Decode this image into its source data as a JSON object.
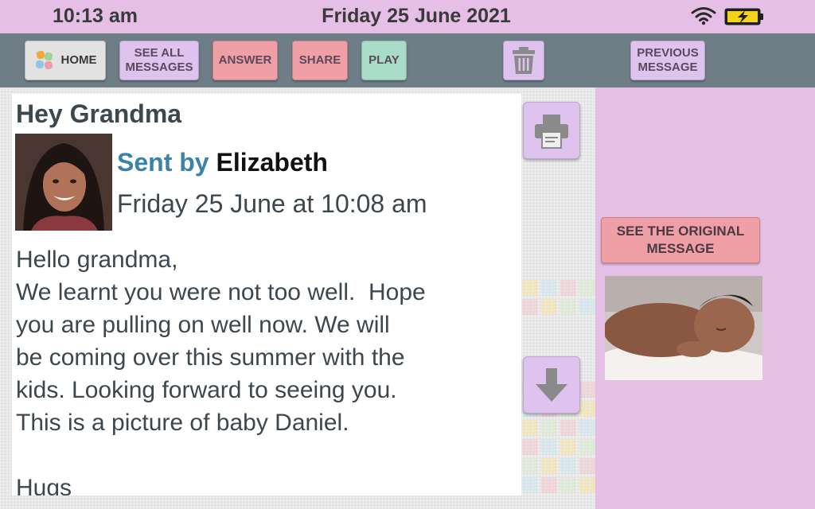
{
  "status_bar": {
    "time": "10:13 am",
    "date": "Friday 25 June 2021",
    "wifi_icon": "wifi-icon",
    "battery_icon": "battery-charging-icon"
  },
  "toolbar": {
    "home_label": "HOME",
    "see_all_label": "SEE ALL\nMESSAGES",
    "answer_label": "ANSWER",
    "share_label": "SHARE",
    "play_label": "PLAY",
    "trash_icon": "trash-icon",
    "previous_label": "PREVIOUS\nMESSAGE"
  },
  "message": {
    "title": "Hey Grandma",
    "sent_by_prefix": "Sent by",
    "sender": "Elizabeth",
    "date": "Friday 25 June at 10:08 am",
    "body": "Hello grandma,\nWe learnt you were not too well.  Hope\nyou are pulling on well now. We will\nbe coming over this summer with the\nkids. Looking forward to seeing you.\nThis is a picture of baby Daniel.\n\nHugs"
  },
  "side_buttons": {
    "print_icon": "printer-icon",
    "down_icon": "arrow-down-icon"
  },
  "right_panel": {
    "original_label": "SEE THE ORIGINAL\nMESSAGE"
  },
  "colors": {
    "status_bar": "#e6bfe6",
    "toolbar": "#6e7d86",
    "lilac_button": "#dfc3ef",
    "pink_button": "#ef9fa5",
    "green_button": "#a9dbc9",
    "sent_by_blue": "#3b82a8",
    "text_gray": "#3d474e"
  }
}
